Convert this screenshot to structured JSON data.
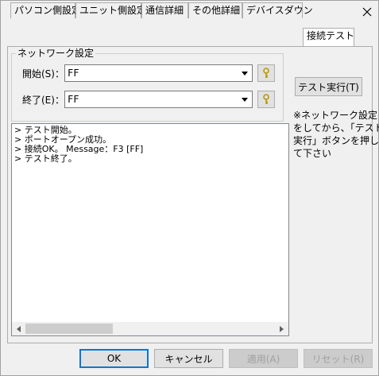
{
  "tabs": [
    {
      "label": "パソコン側設定"
    },
    {
      "label": "ユニット側設定"
    },
    {
      "label": "通信詳細"
    },
    {
      "label": "その他詳細"
    },
    {
      "label": "デバイスダウン"
    },
    {
      "label": "接続テスト"
    }
  ],
  "network": {
    "group_title": "ネットワーク設定",
    "start_label": "開始(S)：",
    "start_value": "FF",
    "end_label": "終了(E)：",
    "end_value": "FF"
  },
  "test_button": "テスト実行(T)",
  "note_lines": [
    "※ネットワーク設定",
    "をしてから、「テスト",
    "実行」ボタンを押し",
    "て下さい"
  ],
  "log_lines": [
    "> テスト開始。",
    "> ポートオープン成功。",
    "> 接続OK。 Message：F3 [FF]",
    "> テスト終了。"
  ],
  "footer": {
    "ok": "OK",
    "cancel": "キャンセル",
    "apply": "適用(A)",
    "reset": "リセット(R)"
  },
  "icons": {
    "close": "close-icon",
    "dropdown": "chevron-down-icon",
    "key": "key-icon"
  }
}
